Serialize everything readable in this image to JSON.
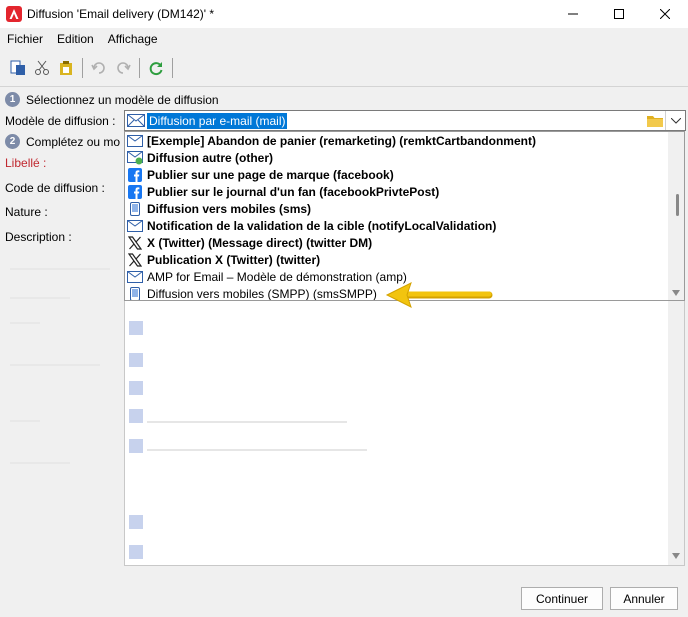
{
  "window": {
    "title": "Diffusion 'Email delivery (DM142)' *",
    "controls": [
      "minimize-icon",
      "maximize-icon",
      "close-icon"
    ]
  },
  "menu": [
    "Fichier",
    "Edition",
    "Affichage"
  ],
  "toolbar": {
    "icons": [
      "new-document-icon",
      "cut-icon",
      "paste-icon",
      "undo-icon",
      "redo-icon",
      "refresh-icon"
    ]
  },
  "steps": {
    "step1": {
      "num": "1",
      "text": "Sélectionnez un modèle de diffusion"
    },
    "step2": {
      "num": "2",
      "text": "Complétez ou mo"
    }
  },
  "form": {
    "template_label": "Modèle de diffusion :",
    "template_value": "Diffusion par e-mail (mail)",
    "libelle_label": "Libellé :",
    "code_label": "Code de diffusion :",
    "nature_label": "Nature :",
    "description_label": "Description :"
  },
  "dropdown": {
    "items": [
      {
        "label": "[Exemple] Abandon de panier (remarketing) (remktCartbandonment)",
        "icon": "email-icon",
        "bold": true
      },
      {
        "label": "Diffusion autre (other)",
        "icon": "other-delivery-icon",
        "bold": true
      },
      {
        "label": "Publier sur une page de marque (facebook)",
        "icon": "facebook-icon",
        "bold": true
      },
      {
        "label": "Publier sur le journal d'un fan (facebookPrivtePost)",
        "icon": "facebook-icon",
        "bold": true
      },
      {
        "label": "Diffusion vers mobiles (sms)",
        "icon": "mobile-icon",
        "bold": true
      },
      {
        "label": "Notification de la validation de la cible (notifyLocalValidation)",
        "icon": "email-icon",
        "bold": true
      },
      {
        "label": "X (Twitter) (Message direct) (twitter DM)",
        "icon": "x-twitter-icon",
        "bold": true
      },
      {
        "label": "Publication X (Twitter) (twitter)",
        "icon": "x-twitter-icon",
        "bold": true
      },
      {
        "label": "AMP for Email – Modèle de démonstration (amp)",
        "icon": "email-icon",
        "bold": false
      },
      {
        "label": "Diffusion vers mobiles (SMPP) (smsSMPP)",
        "icon": "mobile-icon",
        "bold": false
      }
    ]
  },
  "buttons": {
    "continue": "Continuer",
    "cancel": "Annuler"
  },
  "colors": {
    "selection": "#0078d7",
    "annotation_arrow": "#f2c40f",
    "step_badge": "#7d8ba8"
  }
}
